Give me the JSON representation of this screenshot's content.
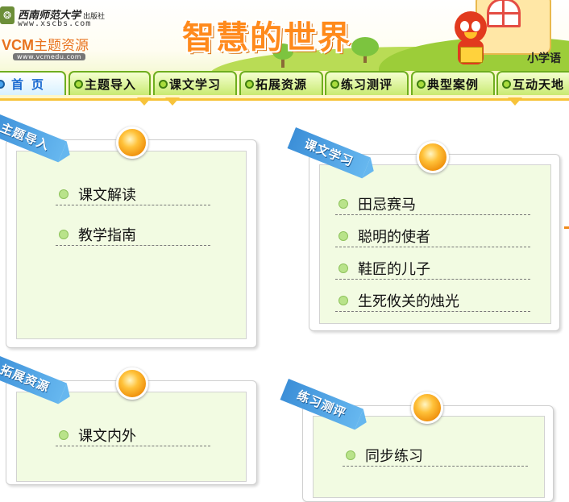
{
  "header": {
    "publisher_name": "西南师范大学",
    "publisher_suffix": "出版社",
    "publisher_url": "www.xscbs.com",
    "brand": "VCM",
    "brand_suffix": "主题资源",
    "brand_url": "www.vcmedu.com",
    "site_title": "智慧的世界",
    "subject_label": "小学语"
  },
  "nav": {
    "tabs": [
      {
        "label": "首页"
      },
      {
        "label": "主题导入"
      },
      {
        "label": "课文学习"
      },
      {
        "label": "拓展资源"
      },
      {
        "label": "练习测评"
      },
      {
        "label": "典型案例"
      },
      {
        "label": "互动天地"
      }
    ]
  },
  "panels": {
    "intro": {
      "ribbon": "主题导入",
      "items": [
        {
          "label": "课文解读"
        },
        {
          "label": "教学指南"
        }
      ]
    },
    "study": {
      "ribbon": "课文学习",
      "items": [
        {
          "label": "田忌赛马"
        },
        {
          "label": "聪明的使者"
        },
        {
          "label": "鞋匠的儿子"
        },
        {
          "label": "生死攸关的烛光"
        }
      ]
    },
    "extend": {
      "ribbon": "拓展资源",
      "items": [
        {
          "label": "课文内外"
        }
      ]
    },
    "practice": {
      "ribbon": "练习测评",
      "items": [
        {
          "label": "同步练习"
        }
      ]
    }
  },
  "colors": {
    "title_orange": "#ff8a1c",
    "nav_green": "#6fae1f",
    "ribbon_blue": "#3c8fd8",
    "panel_bg": "#f2fbe2"
  }
}
